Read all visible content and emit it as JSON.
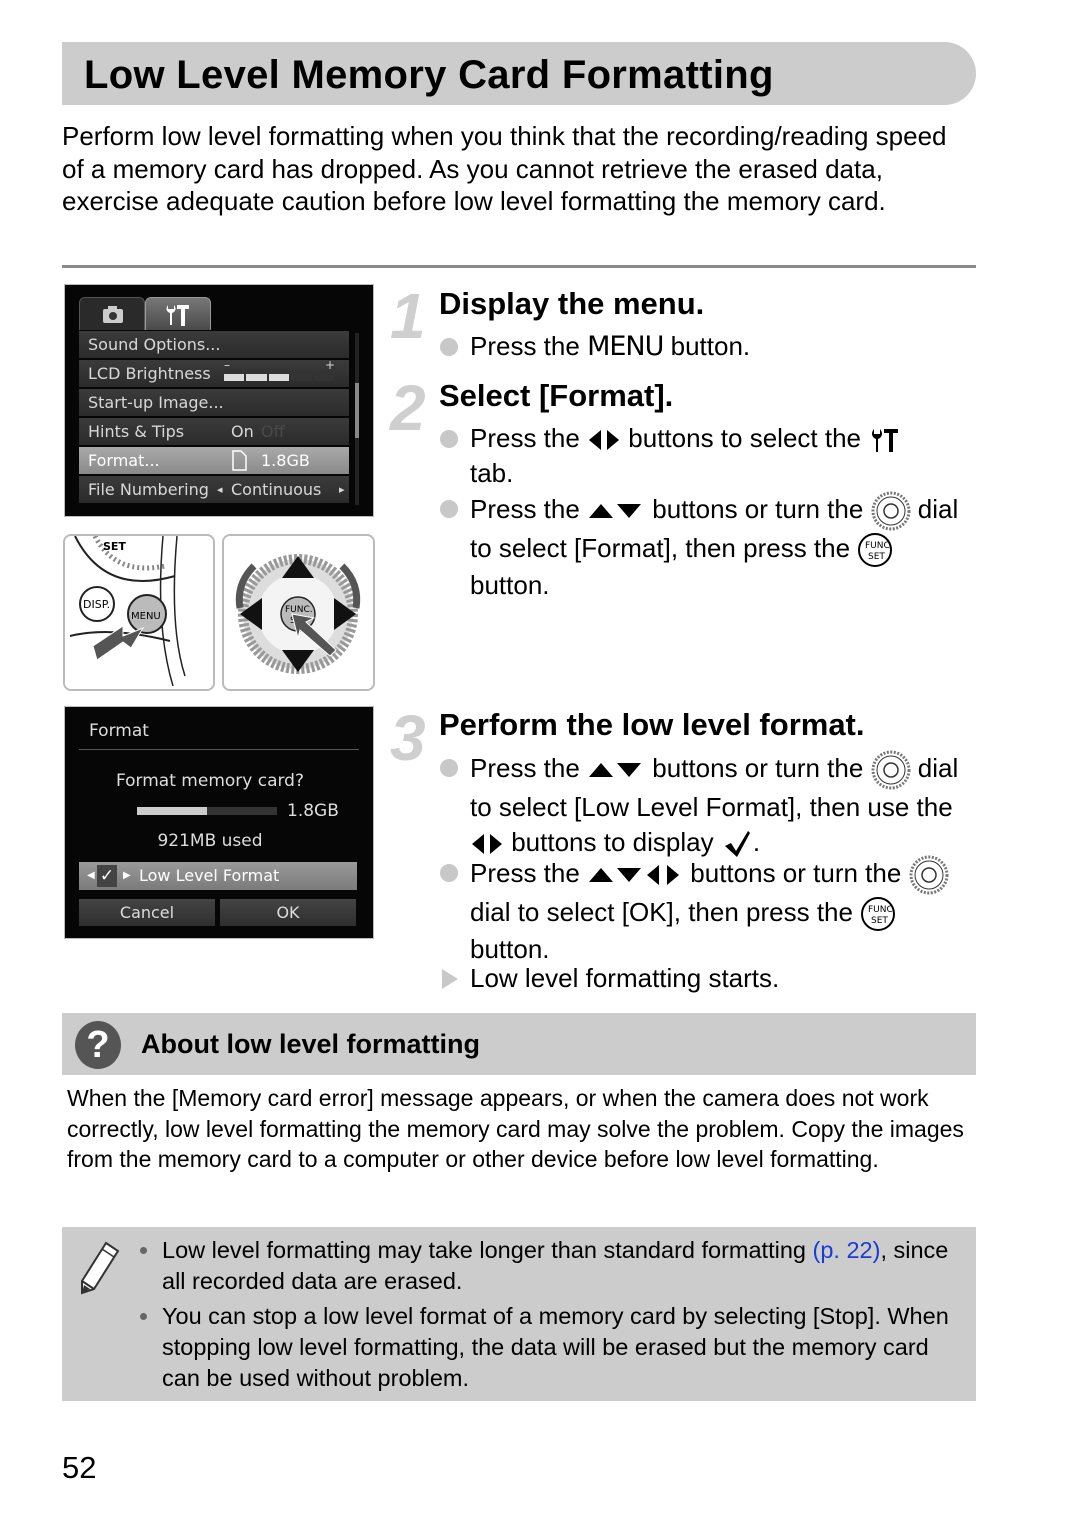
{
  "page": {
    "title": "Low Level Memory Card Formatting",
    "intro": "Perform low level formatting when you think that the recording/reading speed of a memory card has dropped. As you cannot retrieve the erased data, exercise adequate caution before low level formatting the memory card.",
    "page_number": "52"
  },
  "menu_screen": {
    "tabs": [
      {
        "icon": "camera-icon",
        "active": false
      },
      {
        "icon": "wrench-hammer-icon",
        "active": true
      }
    ],
    "rows": [
      {
        "label": "Sound Options...",
        "value": ""
      },
      {
        "label": "LCD Brightness",
        "value": "",
        "brightness_level": 3,
        "brightness_max": 5,
        "min_symbol": "–",
        "max_symbol": "+"
      },
      {
        "label": "Start-up Image...",
        "value": ""
      },
      {
        "label": "Hints & Tips",
        "value": "On",
        "value_off": "Off"
      },
      {
        "label": "Format...",
        "value": "1.8GB",
        "selected": true
      },
      {
        "label": "File Numbering",
        "value": "Continuous",
        "left_arrow": "◂",
        "right_arrow": "▸"
      }
    ]
  },
  "illustrations": {
    "camera_buttons": {
      "disp_label": "DISP.",
      "menu_label": "MENU",
      "set_label": "SET"
    },
    "control_dial": {
      "center_label_1": "FUNC.",
      "center_label_2": "SET"
    }
  },
  "format_screen": {
    "header": "Format",
    "question": "Format memory card?",
    "capacity": "1.8GB",
    "used_fraction": 0.5,
    "used_label": "921MB used",
    "option_label": "Low Level Format",
    "option_checked": true,
    "option_check_symbol": "✓",
    "cancel_label": "Cancel",
    "ok_label": "OK"
  },
  "steps": [
    {
      "number": "1",
      "title": "Display the menu.",
      "bullets": [
        {
          "type": "dot",
          "pre": "Press the ",
          "key": "MENU",
          "post": " button."
        }
      ]
    },
    {
      "number": "2",
      "title": "Select [Format].",
      "bullets": [
        {
          "type": "dot",
          "pre": "Press the ",
          "mid": " buttons to select the ",
          "post": "tab."
        },
        {
          "type": "dot",
          "pre": "Press the ",
          "mid": " buttons or turn the ",
          "mid2": " dial to select [Format], then press the ",
          "post": " button."
        }
      ]
    },
    {
      "number": "3",
      "title": "Perform the low level format.",
      "bullets": [
        {
          "type": "dot",
          "pre": "Press the ",
          "mid": " buttons or turn the ",
          "mid2": " dial to select [Low Level Format], then use the ",
          "mid3": " buttons to display ",
          "post": "."
        },
        {
          "type": "dot",
          "pre": "Press the ",
          "mid": " buttons or turn the ",
          "mid2": " dial to select [OK], then press the ",
          "post": " button."
        },
        {
          "type": "result",
          "text": "Low level formatting starts."
        }
      ]
    }
  ],
  "about": {
    "icon": "question-icon",
    "icon_glyph": "?",
    "title": "About low level formatting",
    "text": "When the [Memory card error] message appears, or when the camera does not work correctly, low level formatting the memory card may solve the problem. Copy the images from the memory card to a computer or other device before low level formatting."
  },
  "notes": {
    "icon": "pencil-icon",
    "items": [
      {
        "pre": "Low level formatting may take longer than standard formatting ",
        "link": "(p. 22)",
        "post": ", since all recorded data are erased."
      },
      {
        "pre": "You can stop a low level format of a memory card by selecting [Stop]. When stopping low level formatting, the data will be erased but the memory card can be used without problem.",
        "link": "",
        "post": ""
      }
    ]
  }
}
